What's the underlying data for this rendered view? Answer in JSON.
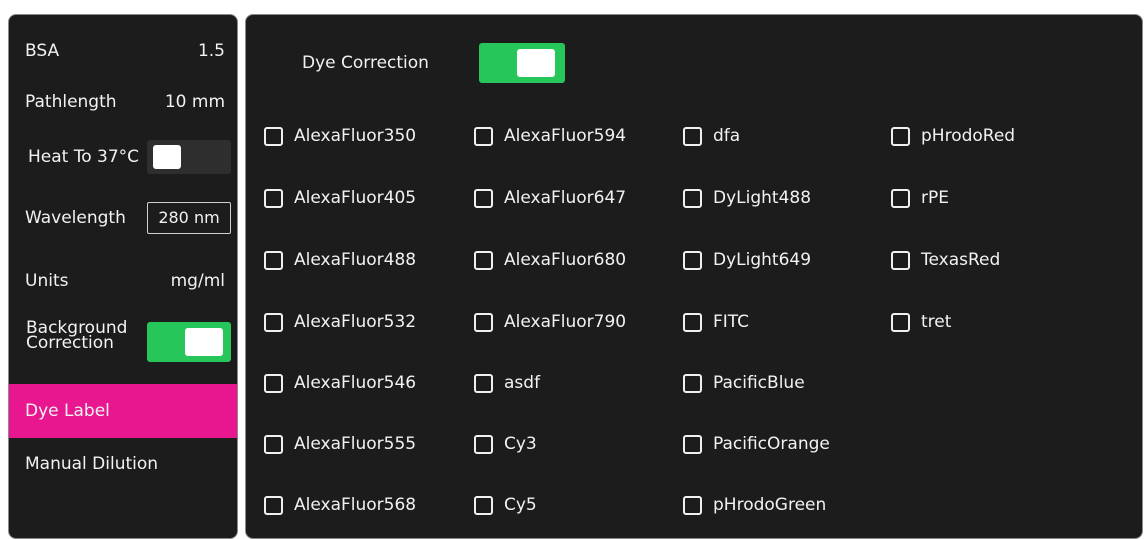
{
  "colors": {
    "panel_bg": "#1c1c1c",
    "accent_pink": "#e8168f",
    "toggle_on_green": "#27c65a",
    "toggle_off_dark": "#2e2e2e"
  },
  "sidebar": {
    "bsa": {
      "label": "BSA",
      "value": "1.5"
    },
    "pathlength": {
      "label": "Pathlength",
      "value": "10 mm"
    },
    "heat": {
      "label": "Heat To 37°C",
      "toggle_on": false
    },
    "wavelength": {
      "label": "Wavelength",
      "value": "280 nm"
    },
    "units": {
      "label": "Units",
      "value": "mg/ml"
    },
    "background_correction": {
      "label_line1": "Background",
      "label_line2": "Correction",
      "toggle_on": true
    },
    "nav": {
      "dye_label": "Dye Label",
      "manual_dilution": "Manual Dilution"
    }
  },
  "main": {
    "dye_correction": {
      "label": "Dye Correction",
      "toggle_on": true
    },
    "columns": [
      [
        "AlexaFluor350",
        "AlexaFluor405",
        "AlexaFluor488",
        "AlexaFluor532",
        "AlexaFluor546",
        "AlexaFluor555",
        "AlexaFluor568"
      ],
      [
        "AlexaFluor594",
        "AlexaFluor647",
        "AlexaFluor680",
        "AlexaFluor790",
        "asdf",
        "Cy3",
        "Cy5"
      ],
      [
        "dfa",
        "DyLight488",
        "DyLight649",
        "FITC",
        "PacificBlue",
        "PacificOrange",
        "pHrodoGreen"
      ],
      [
        "pHrodoRed",
        "rPE",
        "TexasRed",
        "tret"
      ]
    ]
  }
}
